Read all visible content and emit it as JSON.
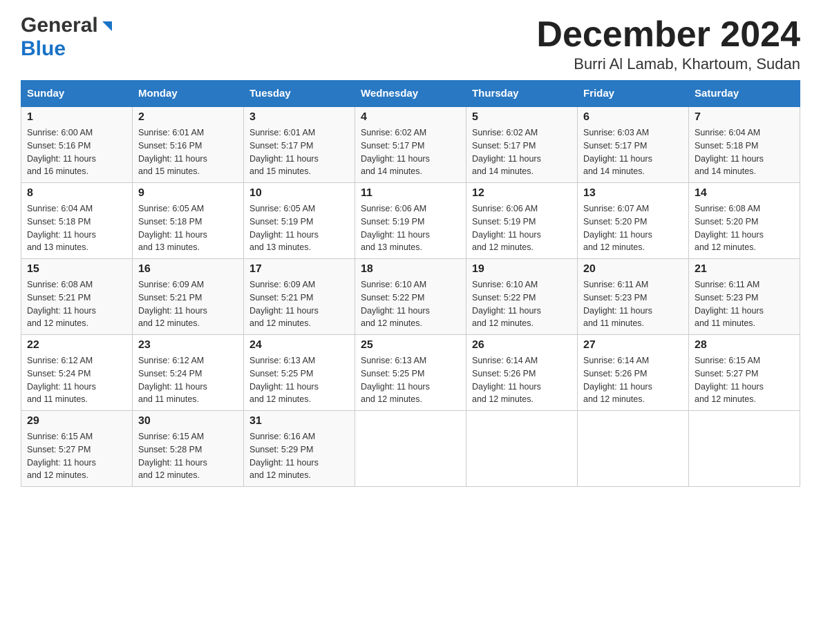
{
  "header": {
    "logo_general": "General",
    "logo_blue": "Blue",
    "title": "December 2024",
    "location": "Burri Al Lamab, Khartoum, Sudan"
  },
  "weekdays": [
    "Sunday",
    "Monday",
    "Tuesday",
    "Wednesday",
    "Thursday",
    "Friday",
    "Saturday"
  ],
  "weeks": [
    [
      {
        "num": "1",
        "sunrise": "6:00 AM",
        "sunset": "5:16 PM",
        "daylight": "11 hours and 16 minutes."
      },
      {
        "num": "2",
        "sunrise": "6:01 AM",
        "sunset": "5:16 PM",
        "daylight": "11 hours and 15 minutes."
      },
      {
        "num": "3",
        "sunrise": "6:01 AM",
        "sunset": "5:17 PM",
        "daylight": "11 hours and 15 minutes."
      },
      {
        "num": "4",
        "sunrise": "6:02 AM",
        "sunset": "5:17 PM",
        "daylight": "11 hours and 14 minutes."
      },
      {
        "num": "5",
        "sunrise": "6:02 AM",
        "sunset": "5:17 PM",
        "daylight": "11 hours and 14 minutes."
      },
      {
        "num": "6",
        "sunrise": "6:03 AM",
        "sunset": "5:17 PM",
        "daylight": "11 hours and 14 minutes."
      },
      {
        "num": "7",
        "sunrise": "6:04 AM",
        "sunset": "5:18 PM",
        "daylight": "11 hours and 14 minutes."
      }
    ],
    [
      {
        "num": "8",
        "sunrise": "6:04 AM",
        "sunset": "5:18 PM",
        "daylight": "11 hours and 13 minutes."
      },
      {
        "num": "9",
        "sunrise": "6:05 AM",
        "sunset": "5:18 PM",
        "daylight": "11 hours and 13 minutes."
      },
      {
        "num": "10",
        "sunrise": "6:05 AM",
        "sunset": "5:19 PM",
        "daylight": "11 hours and 13 minutes."
      },
      {
        "num": "11",
        "sunrise": "6:06 AM",
        "sunset": "5:19 PM",
        "daylight": "11 hours and 13 minutes."
      },
      {
        "num": "12",
        "sunrise": "6:06 AM",
        "sunset": "5:19 PM",
        "daylight": "11 hours and 12 minutes."
      },
      {
        "num": "13",
        "sunrise": "6:07 AM",
        "sunset": "5:20 PM",
        "daylight": "11 hours and 12 minutes."
      },
      {
        "num": "14",
        "sunrise": "6:08 AM",
        "sunset": "5:20 PM",
        "daylight": "11 hours and 12 minutes."
      }
    ],
    [
      {
        "num": "15",
        "sunrise": "6:08 AM",
        "sunset": "5:21 PM",
        "daylight": "11 hours and 12 minutes."
      },
      {
        "num": "16",
        "sunrise": "6:09 AM",
        "sunset": "5:21 PM",
        "daylight": "11 hours and 12 minutes."
      },
      {
        "num": "17",
        "sunrise": "6:09 AM",
        "sunset": "5:21 PM",
        "daylight": "11 hours and 12 minutes."
      },
      {
        "num": "18",
        "sunrise": "6:10 AM",
        "sunset": "5:22 PM",
        "daylight": "11 hours and 12 minutes."
      },
      {
        "num": "19",
        "sunrise": "6:10 AM",
        "sunset": "5:22 PM",
        "daylight": "11 hours and 12 minutes."
      },
      {
        "num": "20",
        "sunrise": "6:11 AM",
        "sunset": "5:23 PM",
        "daylight": "11 hours and 11 minutes."
      },
      {
        "num": "21",
        "sunrise": "6:11 AM",
        "sunset": "5:23 PM",
        "daylight": "11 hours and 11 minutes."
      }
    ],
    [
      {
        "num": "22",
        "sunrise": "6:12 AM",
        "sunset": "5:24 PM",
        "daylight": "11 hours and 11 minutes."
      },
      {
        "num": "23",
        "sunrise": "6:12 AM",
        "sunset": "5:24 PM",
        "daylight": "11 hours and 11 minutes."
      },
      {
        "num": "24",
        "sunrise": "6:13 AM",
        "sunset": "5:25 PM",
        "daylight": "11 hours and 12 minutes."
      },
      {
        "num": "25",
        "sunrise": "6:13 AM",
        "sunset": "5:25 PM",
        "daylight": "11 hours and 12 minutes."
      },
      {
        "num": "26",
        "sunrise": "6:14 AM",
        "sunset": "5:26 PM",
        "daylight": "11 hours and 12 minutes."
      },
      {
        "num": "27",
        "sunrise": "6:14 AM",
        "sunset": "5:26 PM",
        "daylight": "11 hours and 12 minutes."
      },
      {
        "num": "28",
        "sunrise": "6:15 AM",
        "sunset": "5:27 PM",
        "daylight": "11 hours and 12 minutes."
      }
    ],
    [
      {
        "num": "29",
        "sunrise": "6:15 AM",
        "sunset": "5:27 PM",
        "daylight": "11 hours and 12 minutes."
      },
      {
        "num": "30",
        "sunrise": "6:15 AM",
        "sunset": "5:28 PM",
        "daylight": "11 hours and 12 minutes."
      },
      {
        "num": "31",
        "sunrise": "6:16 AM",
        "sunset": "5:29 PM",
        "daylight": "11 hours and 12 minutes."
      },
      null,
      null,
      null,
      null
    ]
  ]
}
